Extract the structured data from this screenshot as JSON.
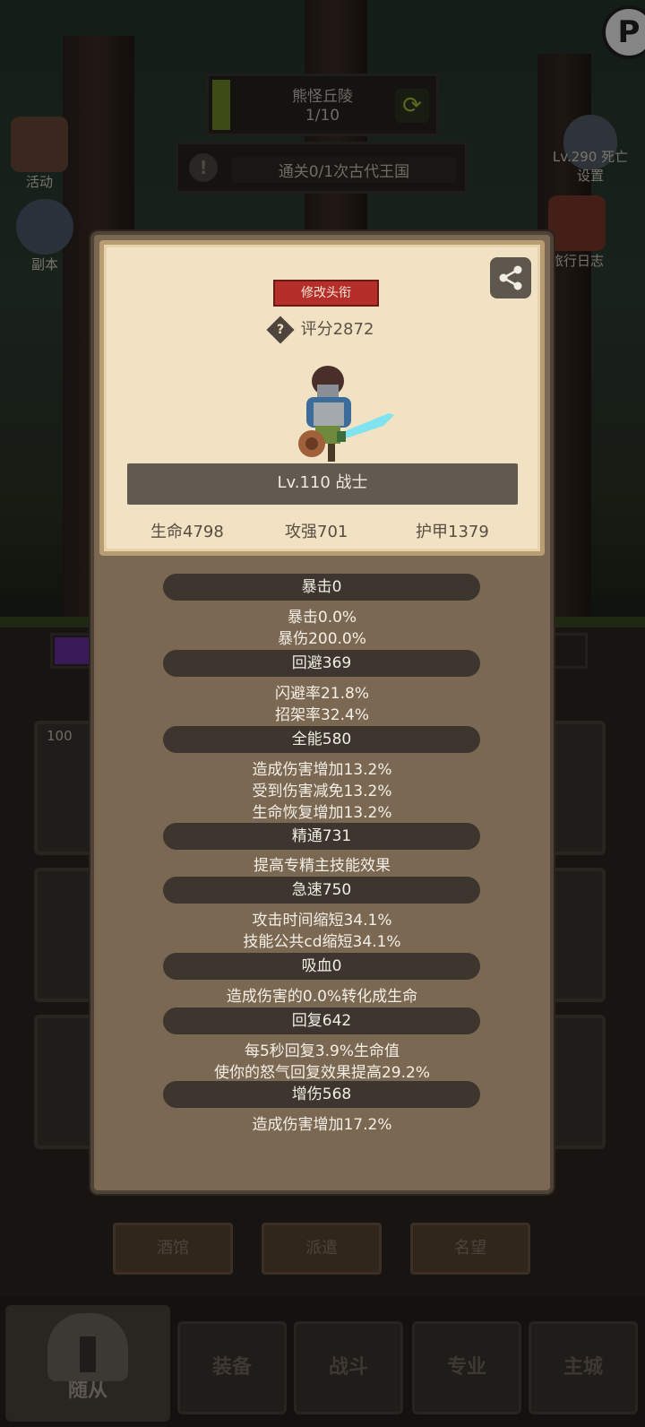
{
  "game": {
    "zone_name": "熊怪丘陵",
    "zone_progress": "1/10",
    "quest_text": "通关0/1次古代王国",
    "side_left": [
      "活动",
      "副本"
    ],
    "side_right": [
      "Lv.290 死亡",
      "设置",
      "旅行日志"
    ],
    "dim_level": "100",
    "dim_tabs": [
      "酒馆",
      "派遣",
      "名望"
    ],
    "nav": [
      "随从",
      "装备",
      "战斗",
      "专业",
      "主城"
    ]
  },
  "panel": {
    "title_button": "修改头衔",
    "score": "评分2872",
    "level_class": "Lv.110 战士",
    "hp": "生命4798",
    "atk": "攻强701",
    "armor": "护甲1379",
    "sections": [
      {
        "head": "暴击0",
        "lines": [
          "暴击0.0%",
          "暴伤200.0%"
        ]
      },
      {
        "head": "回避369",
        "lines": [
          "闪避率21.8%",
          "招架率32.4%"
        ]
      },
      {
        "head": "全能580",
        "lines": [
          "造成伤害增加13.2%",
          "受到伤害减免13.2%",
          "生命恢复增加13.2%"
        ]
      },
      {
        "head": "精通731",
        "lines": [
          "提高专精主技能效果"
        ]
      },
      {
        "head": "急速750",
        "lines": [
          "攻击时间缩短34.1%",
          "技能公共cd缩短34.1%"
        ]
      },
      {
        "head": "吸血0",
        "lines": [
          "造成伤害的0.0%转化成生命"
        ]
      },
      {
        "head": "回复642",
        "lines": [
          "每5秒回复3.9%生命值",
          "使你的怒气回复效果提高29.2%"
        ]
      },
      {
        "head": "增伤568",
        "lines": [
          "造成伤害增加17.2%"
        ]
      }
    ]
  },
  "icons": {
    "share": "share-icon",
    "help": "help-icon",
    "refresh": "refresh-icon"
  },
  "colors": {
    "title_button": "#b52f2a",
    "card_bg": "#f0e2c3",
    "panel_bg": "#7a6852"
  }
}
